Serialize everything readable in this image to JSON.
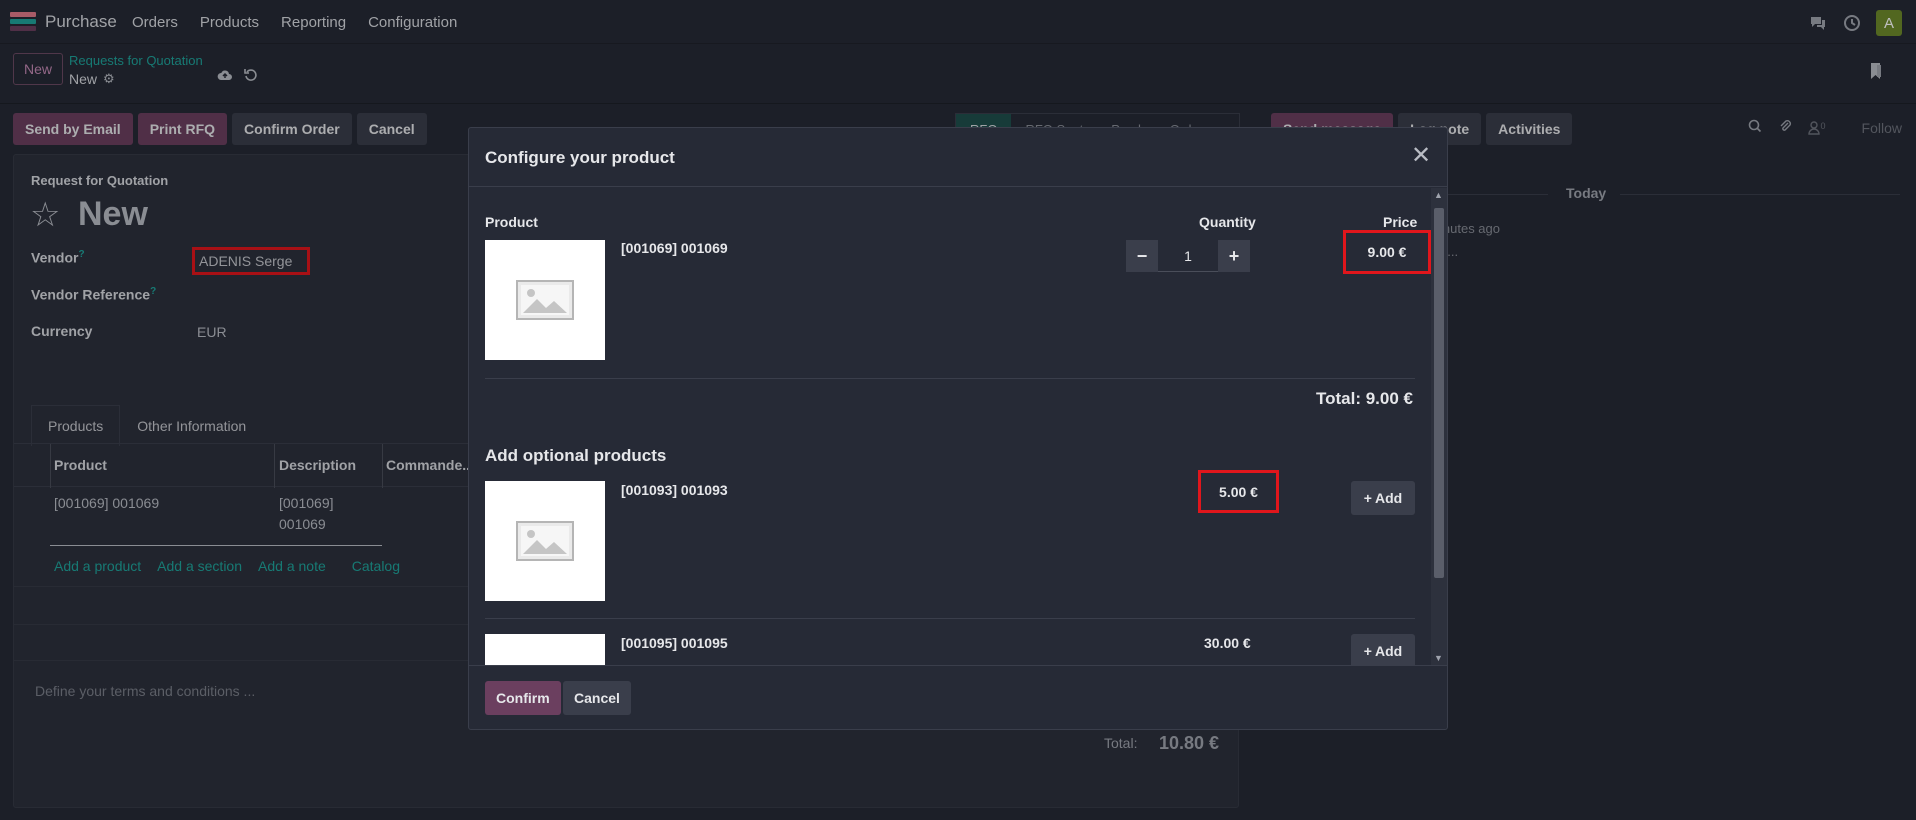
{
  "navbar": {
    "app_name": "Purchase",
    "menu": [
      "Orders",
      "Products",
      "Reporting",
      "Configuration"
    ],
    "avatar_letter": "A",
    "icons": [
      "chat-icon",
      "clock-icon"
    ]
  },
  "control": {
    "new_label": "New",
    "breadcrumb_parent": "Requests for Quotation",
    "breadcrumb_current": "New"
  },
  "actions": {
    "send_email": "Send by Email",
    "print_rfq": "Print RFQ",
    "confirm_order": "Confirm Order",
    "cancel": "Cancel"
  },
  "status": [
    "RFQ",
    "RFQ Sent",
    "Purchase Order"
  ],
  "chatter": {
    "send_message": "Send message",
    "log_note": "Log note",
    "activities": "Activities",
    "follow": "Follow",
    "follower_count": "0",
    "today": "Today",
    "frag1": "inutes ago",
    "frag2": "d..."
  },
  "form": {
    "doc_type": "Request for Quotation",
    "title": "New",
    "vendor_label": "Vendor",
    "vendor_value": "ADENIS  Serge",
    "vendor_ref_label": "Vendor Reference",
    "currency_label": "Currency",
    "currency_value": "EUR",
    "help_mark": "?",
    "tabs": [
      "Products",
      "Other Information"
    ],
    "columns": [
      "Product",
      "Description",
      "Commande..."
    ],
    "row": {
      "product": "[001069] 001069",
      "desc_line1": "[001069]",
      "desc_line2": "001069"
    },
    "links": [
      "Add a product",
      "Add a section",
      "Add a note",
      "Catalog"
    ],
    "terms_placeholder": "Define your terms and conditions ...",
    "total_label": "Total:",
    "total_value": "10.80 €"
  },
  "modal": {
    "title": "Configure your product",
    "header_product": "Product",
    "header_quantity": "Quantity",
    "header_price": "Price",
    "main_product": "[001069] 001069",
    "quantity": "1",
    "price": "9.00 €",
    "total": "Total: 9.00 €",
    "optional_title": "Add optional products",
    "optional": [
      {
        "name": "[001093] 001093",
        "price": "5.00 €",
        "add": "Add"
      },
      {
        "name": "[001095] 001095",
        "price": "30.00 €",
        "add": "Add"
      }
    ],
    "confirm": "Confirm",
    "cancel": "Cancel"
  },
  "colors": {
    "accent_primary": "#6b3f5f",
    "link_teal": "#1fa39b",
    "highlight_red": "#e0161c"
  }
}
